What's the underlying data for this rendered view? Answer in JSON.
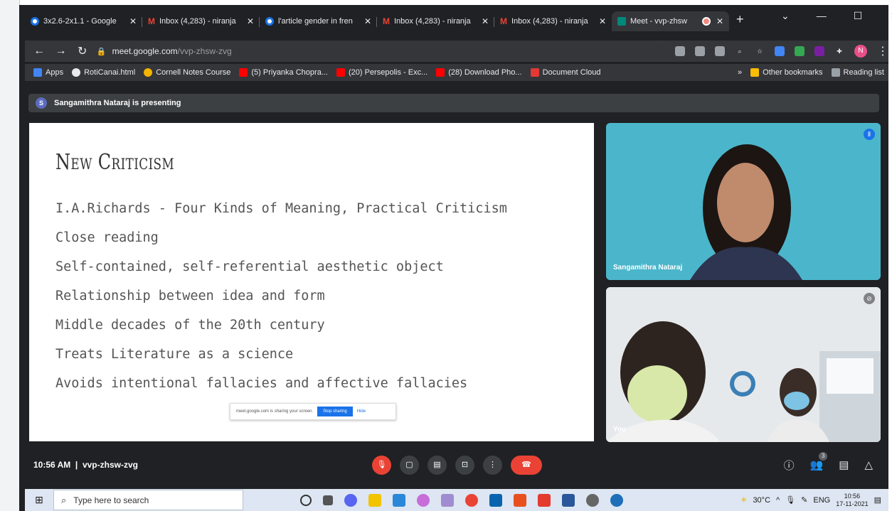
{
  "browser": {
    "tabs": [
      {
        "label": "3x2.6-2x1.1 - Google",
        "icon": "google-icon"
      },
      {
        "label": "Inbox (4,283) - niranja",
        "icon": "gmail-icon"
      },
      {
        "label": "l'article gender in fren",
        "icon": "google-icon"
      },
      {
        "label": "Inbox (4,283) - niranja",
        "icon": "gmail-icon"
      },
      {
        "label": "Inbox (4,283) - niranja",
        "icon": "gmail-icon"
      },
      {
        "label": "Meet - vvp-zhsw",
        "icon": "meet-icon",
        "active": true
      }
    ],
    "url_host": "meet.google.com",
    "url_path": "/vvp-zhsw-zvg",
    "profile_initial": "N",
    "bookmarks": [
      {
        "label": "Apps"
      },
      {
        "label": "RotiCanai.html"
      },
      {
        "label": "Cornell Notes Course"
      },
      {
        "label": "(5) Priyanka Chopra..."
      },
      {
        "label": "(20) Persepolis - Exc..."
      },
      {
        "label": "(28) Download Pho..."
      },
      {
        "label": "Document Cloud"
      }
    ],
    "bookmarks_right": {
      "overflow": "»",
      "other": "Other bookmarks",
      "reading": "Reading list"
    }
  },
  "meet": {
    "presenter_initial": "S",
    "presenting_text": "Sangamithra Nataraj is presenting",
    "time": "10:56 AM",
    "meeting_code": "vvp-zhsw-zvg",
    "people_count": "3",
    "tiles": [
      {
        "name": "Sangamithra Nataraj"
      },
      {
        "name": "You"
      }
    ]
  },
  "slide": {
    "title": "New Criticism",
    "bullets": [
      "I.A.Richards - Four Kinds of Meaning, Practical Criticism",
      "Close reading",
      "Self-contained, self-referential aesthetic object",
      "Relationship between idea and form",
      "Middle decades of the 20th century",
      "Treats Literature as a science",
      "Avoids intentional fallacies and affective fallacies"
    ],
    "share_banner": {
      "text": "meet.google.com is sharing your screen.",
      "stop": "Stop sharing",
      "hide": "Hide"
    }
  },
  "taskbar": {
    "search_placeholder": "Type here to search",
    "weather": "30°C",
    "lang": "ENG",
    "time": "10:56",
    "date": "17-11-2021"
  }
}
